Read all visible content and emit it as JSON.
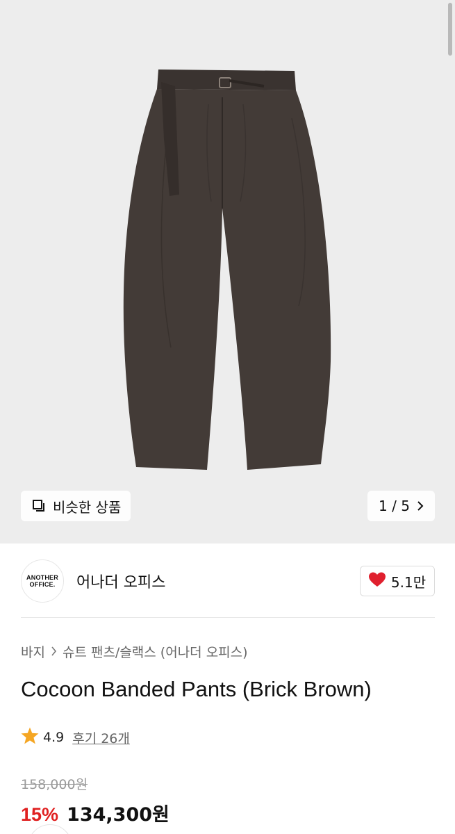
{
  "gallery": {
    "similar_label": "비슷한 상품",
    "pager_label": "1 / 5",
    "icon_similar": "copy-icon",
    "icon_next": "chevron-right-icon"
  },
  "brand": {
    "logo_line1": "ANOTHER",
    "logo_line2": "OFFICE.",
    "name": "어나더 오피스",
    "likes": "5.1만",
    "like_icon": "heart-icon",
    "like_color": "#e0202e"
  },
  "breadcrumb": {
    "category": "바지",
    "subcategory": "슈트 팬츠/슬랙스 (어나더 오피스)"
  },
  "product": {
    "title": "Cocoon Banded Pants (Brick Brown)",
    "rating": "4.9",
    "reviews": "후기 26개",
    "original_price": "158,000원",
    "discount": "15%",
    "sale_price": "134,300원",
    "accent_color": "#e02020",
    "star_color": "#f5a623"
  }
}
